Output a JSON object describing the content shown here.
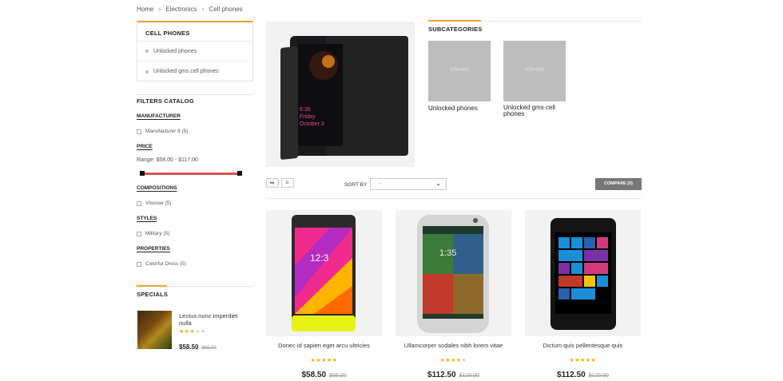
{
  "breadcrumb": {
    "home": "Home",
    "category": "Electronics",
    "current": "Cell phones"
  },
  "sidebar": {
    "category_title": "CELL PHONES",
    "category_items": [
      {
        "label": "Unlocked phones"
      },
      {
        "label": "Unlocked gms cell phones"
      }
    ],
    "filters_title": "FILTERS CATALOG",
    "manufacturer": {
      "title": "MANUFACTURER",
      "option": "Manufacturer 6 (5)"
    },
    "price": {
      "title": "PRICE",
      "range": "Range: $58.00 - $117.00"
    },
    "compositions": {
      "title": "COMPOSITIONS",
      "option": "Viscose (5)"
    },
    "styles": {
      "title": "STYLES",
      "option": "Military (5)"
    },
    "properties": {
      "title": "PROPERTIES",
      "option": "Colorful Dress (5)"
    },
    "specials_title": "SPECIALS",
    "special": {
      "name": "Lectus nunc imperdiet nulla",
      "price": "$58.50",
      "old_price": "$65.00",
      "rating": 3
    }
  },
  "subcategories": {
    "title": "SUBCATEGORIES",
    "items": [
      {
        "label": "Unlocked phones",
        "size": "370×420"
      },
      {
        "label": "Unlocked gms cell phones",
        "size": "370×420"
      }
    ]
  },
  "toolbar": {
    "sort_label": "SORT BY",
    "sort_value": "--",
    "compare_label": "COMPARE (0)"
  },
  "products": [
    {
      "name": "Donec id sapien eget arcu ultricies",
      "price": "$58.50",
      "old_price": "$65.00",
      "rating": 5
    },
    {
      "name": "Ullamcorper sodales nibh lorem vitae",
      "price": "$112.50",
      "old_price": "$125.00",
      "rating": 4
    },
    {
      "name": "Dictum quis pellentesque quis",
      "price": "$112.50",
      "old_price": "$125.00",
      "rating": 5
    }
  ],
  "banner_phone_text": {
    "time": "6:35",
    "day": "Friday",
    "date": "October 3"
  },
  "colors": {
    "accent": "#e8a13a",
    "slider": "#d9534f",
    "star": "#f0b000"
  }
}
